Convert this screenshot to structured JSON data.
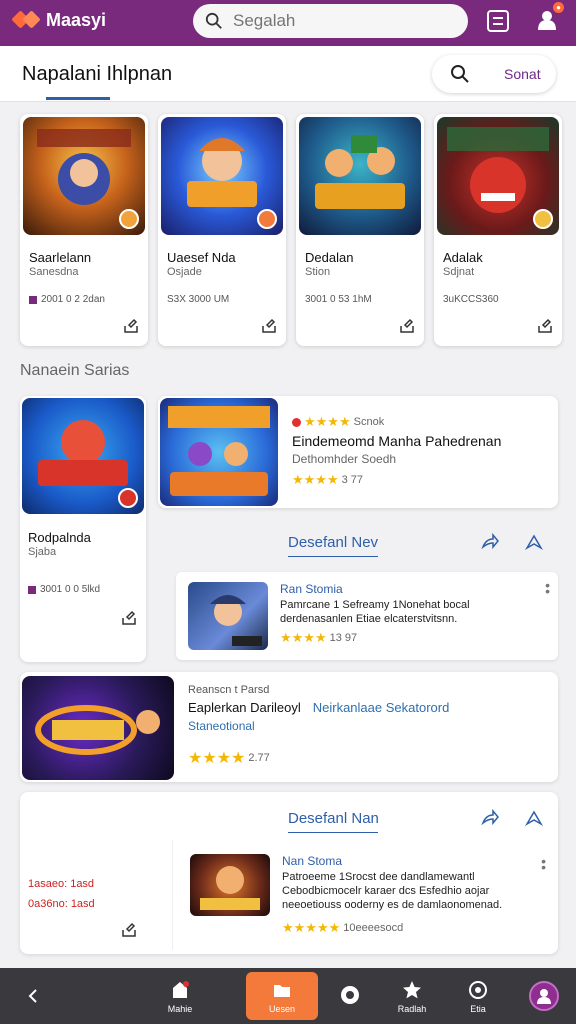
{
  "app": {
    "name": "Maasyi"
  },
  "search": {
    "placeholder": "Segalah"
  },
  "header": {
    "title": "Napalani Ihlpnan",
    "action_label": "Sonat"
  },
  "featured": [
    {
      "name": "Saarlelann",
      "sub": "Sanesdna",
      "meta": "2001 0 2 2dan",
      "badge_color": "#f2a23a"
    },
    {
      "name": "Uaesef Nda",
      "sub": "Osjade",
      "meta": "S3X 3000 UM",
      "badge_color": "#f27a3a"
    },
    {
      "name": "Dedalan",
      "sub": "Stion",
      "meta": "3001 0 53 1hM",
      "badge_color": "#e0a020"
    },
    {
      "name": "Adalak",
      "sub": "Sdjnat",
      "meta": "3uKCCS360",
      "badge_color": "#f2c040"
    }
  ],
  "section": {
    "label": "Nanaein Sarias"
  },
  "left_panel": {
    "name": "Rodpalnda",
    "sub": "Sjaba",
    "meta": "3001 0 0 5lkd"
  },
  "main_panel": {
    "top_rating_label": "Scnok",
    "title": "Eindemeomd Manha Pahedrenan",
    "subtitle": "Dethomhder Soedh",
    "rating_value": "3 77"
  },
  "comments_1": {
    "heading": "Desefanl Nev",
    "author": "Ran Stomia",
    "text": "Pamrcane 1 Sefreamy 1Nonehat bocal derdenasanlen Etiae elcaterstvitsnn.",
    "rating_value": "13 97"
  },
  "wide_panel": {
    "label": "Reanscn t Parsd",
    "title": "Eaplerkan Darileoyl",
    "title_link": "Neirkanlaae Sekatorord",
    "sub": "Staneotional",
    "rating_value": "2.77"
  },
  "bottom_panel": {
    "price_a": "1asaeo: 1asd",
    "price_b": "0a36no: 1asd",
    "heading": "Desefanl Nan",
    "author": "Nan Stoma",
    "text": "Patroeeme 1Srocst dee dandlamewantl Cebodbicmocelr karaer dcs Esfedhio aojar neeoetiouss ooderny es de damlaonomenad.",
    "rating_value": "10eeeesocd"
  },
  "nav": {
    "home": "Mahie",
    "active": "Uesen",
    "item3": "",
    "item4": "Radlah",
    "item5": "Etia",
    "item6": ""
  },
  "colors": {
    "brand": "#7a2a7c",
    "accent": "#f37a3a",
    "link": "#2f5fa8",
    "star": "#f5b800"
  }
}
